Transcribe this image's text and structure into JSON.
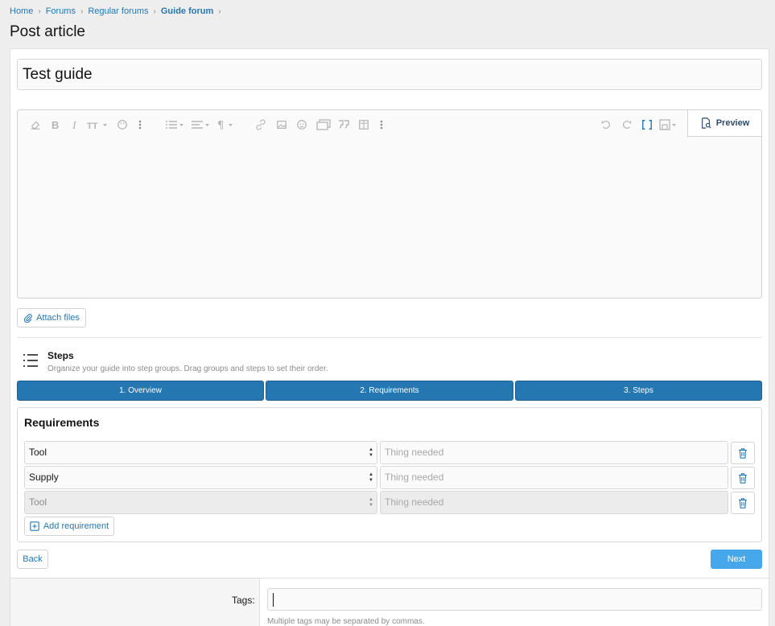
{
  "breadcrumb": {
    "items": [
      "Home",
      "Forums",
      "Regular forums",
      "Guide forum"
    ]
  },
  "page": {
    "title": "Post article"
  },
  "form": {
    "title_value": "Test guide"
  },
  "editor": {
    "preview_label": "Preview",
    "toolbar_icons": [
      "eraser-icon",
      "bold-icon",
      "italic-icon",
      "font-size-icon",
      "color-palette-icon",
      "more-vertical-icon",
      "list-icon",
      "align-icon",
      "paragraph-icon",
      "link-icon",
      "image-icon",
      "smiley-icon",
      "media-icon",
      "quote-icon",
      "table-icon",
      "more-vertical-icon",
      "undo-icon",
      "redo-icon",
      "bbcode-toggle-icon",
      "drafts-icon"
    ]
  },
  "attach": {
    "label": "Attach files"
  },
  "steps": {
    "title": "Steps",
    "description": "Organize your guide into step groups. Drag groups and steps to set their order.",
    "tabs": [
      "1. Overview",
      "2. Requirements",
      "3. Steps"
    ]
  },
  "requirements": {
    "title": "Requirements",
    "rows": [
      {
        "type": "Tool",
        "placeholder": "Thing needed",
        "disabled": false
      },
      {
        "type": "Supply",
        "placeholder": "Thing needed",
        "disabled": false
      },
      {
        "type": "Tool",
        "placeholder": "Thing needed",
        "disabled": true
      }
    ],
    "add_label": "Add requirement"
  },
  "nav": {
    "back_label": "Back",
    "next_label": "Next"
  },
  "tags": {
    "label": "Tags:",
    "value": "",
    "hint": "Multiple tags may be separated by commas."
  },
  "colors": {
    "accent": "#2577b1",
    "primary_button": "#47a7eb"
  }
}
